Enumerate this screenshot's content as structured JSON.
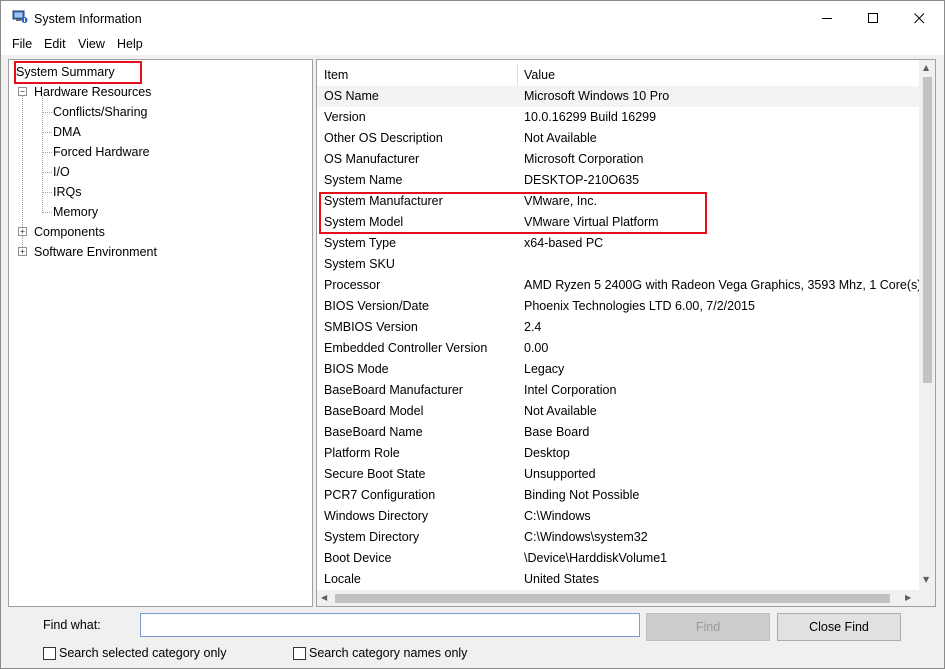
{
  "window": {
    "title": "System Information"
  },
  "menu": [
    "File",
    "Edit",
    "View",
    "Help"
  ],
  "tree": {
    "root": "System Summary",
    "hardware": "Hardware Resources",
    "hardware_children": [
      "Conflicts/Sharing",
      "DMA",
      "Forced Hardware",
      "I/O",
      "IRQs",
      "Memory"
    ],
    "components": "Components",
    "software": "Software Environment"
  },
  "table": {
    "headers": {
      "item": "Item",
      "value": "Value"
    },
    "rows": [
      {
        "item": "OS Name",
        "value": "Microsoft Windows 10 Pro"
      },
      {
        "item": "Version",
        "value": "10.0.16299 Build 16299"
      },
      {
        "item": "Other OS Description",
        "value": "Not Available"
      },
      {
        "item": "OS Manufacturer",
        "value": "Microsoft Corporation"
      },
      {
        "item": "System Name",
        "value": "DESKTOP-210O635"
      },
      {
        "item": "System Manufacturer",
        "value": "VMware, Inc."
      },
      {
        "item": "System Model",
        "value": "VMware Virtual Platform"
      },
      {
        "item": "System Type",
        "value": "x64-based PC"
      },
      {
        "item": "System SKU",
        "value": ""
      },
      {
        "item": "Processor",
        "value": "AMD Ryzen 5 2400G with Radeon Vega Graphics, 3593 Mhz, 1 Core(s)"
      },
      {
        "item": "BIOS Version/Date",
        "value": "Phoenix Technologies LTD 6.00, 7/2/2015"
      },
      {
        "item": "SMBIOS Version",
        "value": "2.4"
      },
      {
        "item": "Embedded Controller Version",
        "value": "0.00"
      },
      {
        "item": "BIOS Mode",
        "value": "Legacy"
      },
      {
        "item": "BaseBoard Manufacturer",
        "value": "Intel Corporation"
      },
      {
        "item": "BaseBoard Model",
        "value": "Not Available"
      },
      {
        "item": "BaseBoard Name",
        "value": "Base Board"
      },
      {
        "item": "Platform Role",
        "value": "Desktop"
      },
      {
        "item": "Secure Boot State",
        "value": "Unsupported"
      },
      {
        "item": "PCR7 Configuration",
        "value": "Binding Not Possible"
      },
      {
        "item": "Windows Directory",
        "value": "C:\\Windows"
      },
      {
        "item": "System Directory",
        "value": "C:\\Windows\\system32"
      },
      {
        "item": "Boot Device",
        "value": "\\Device\\HarddiskVolume1"
      },
      {
        "item": "Locale",
        "value": "United States"
      }
    ]
  },
  "find": {
    "label": "Find what:",
    "value": "",
    "find_button": "Find",
    "close_button": "Close Find",
    "check_selected": "Search selected category only",
    "check_names": "Search category names only"
  },
  "colors": {
    "highlight": "#e3101a"
  }
}
